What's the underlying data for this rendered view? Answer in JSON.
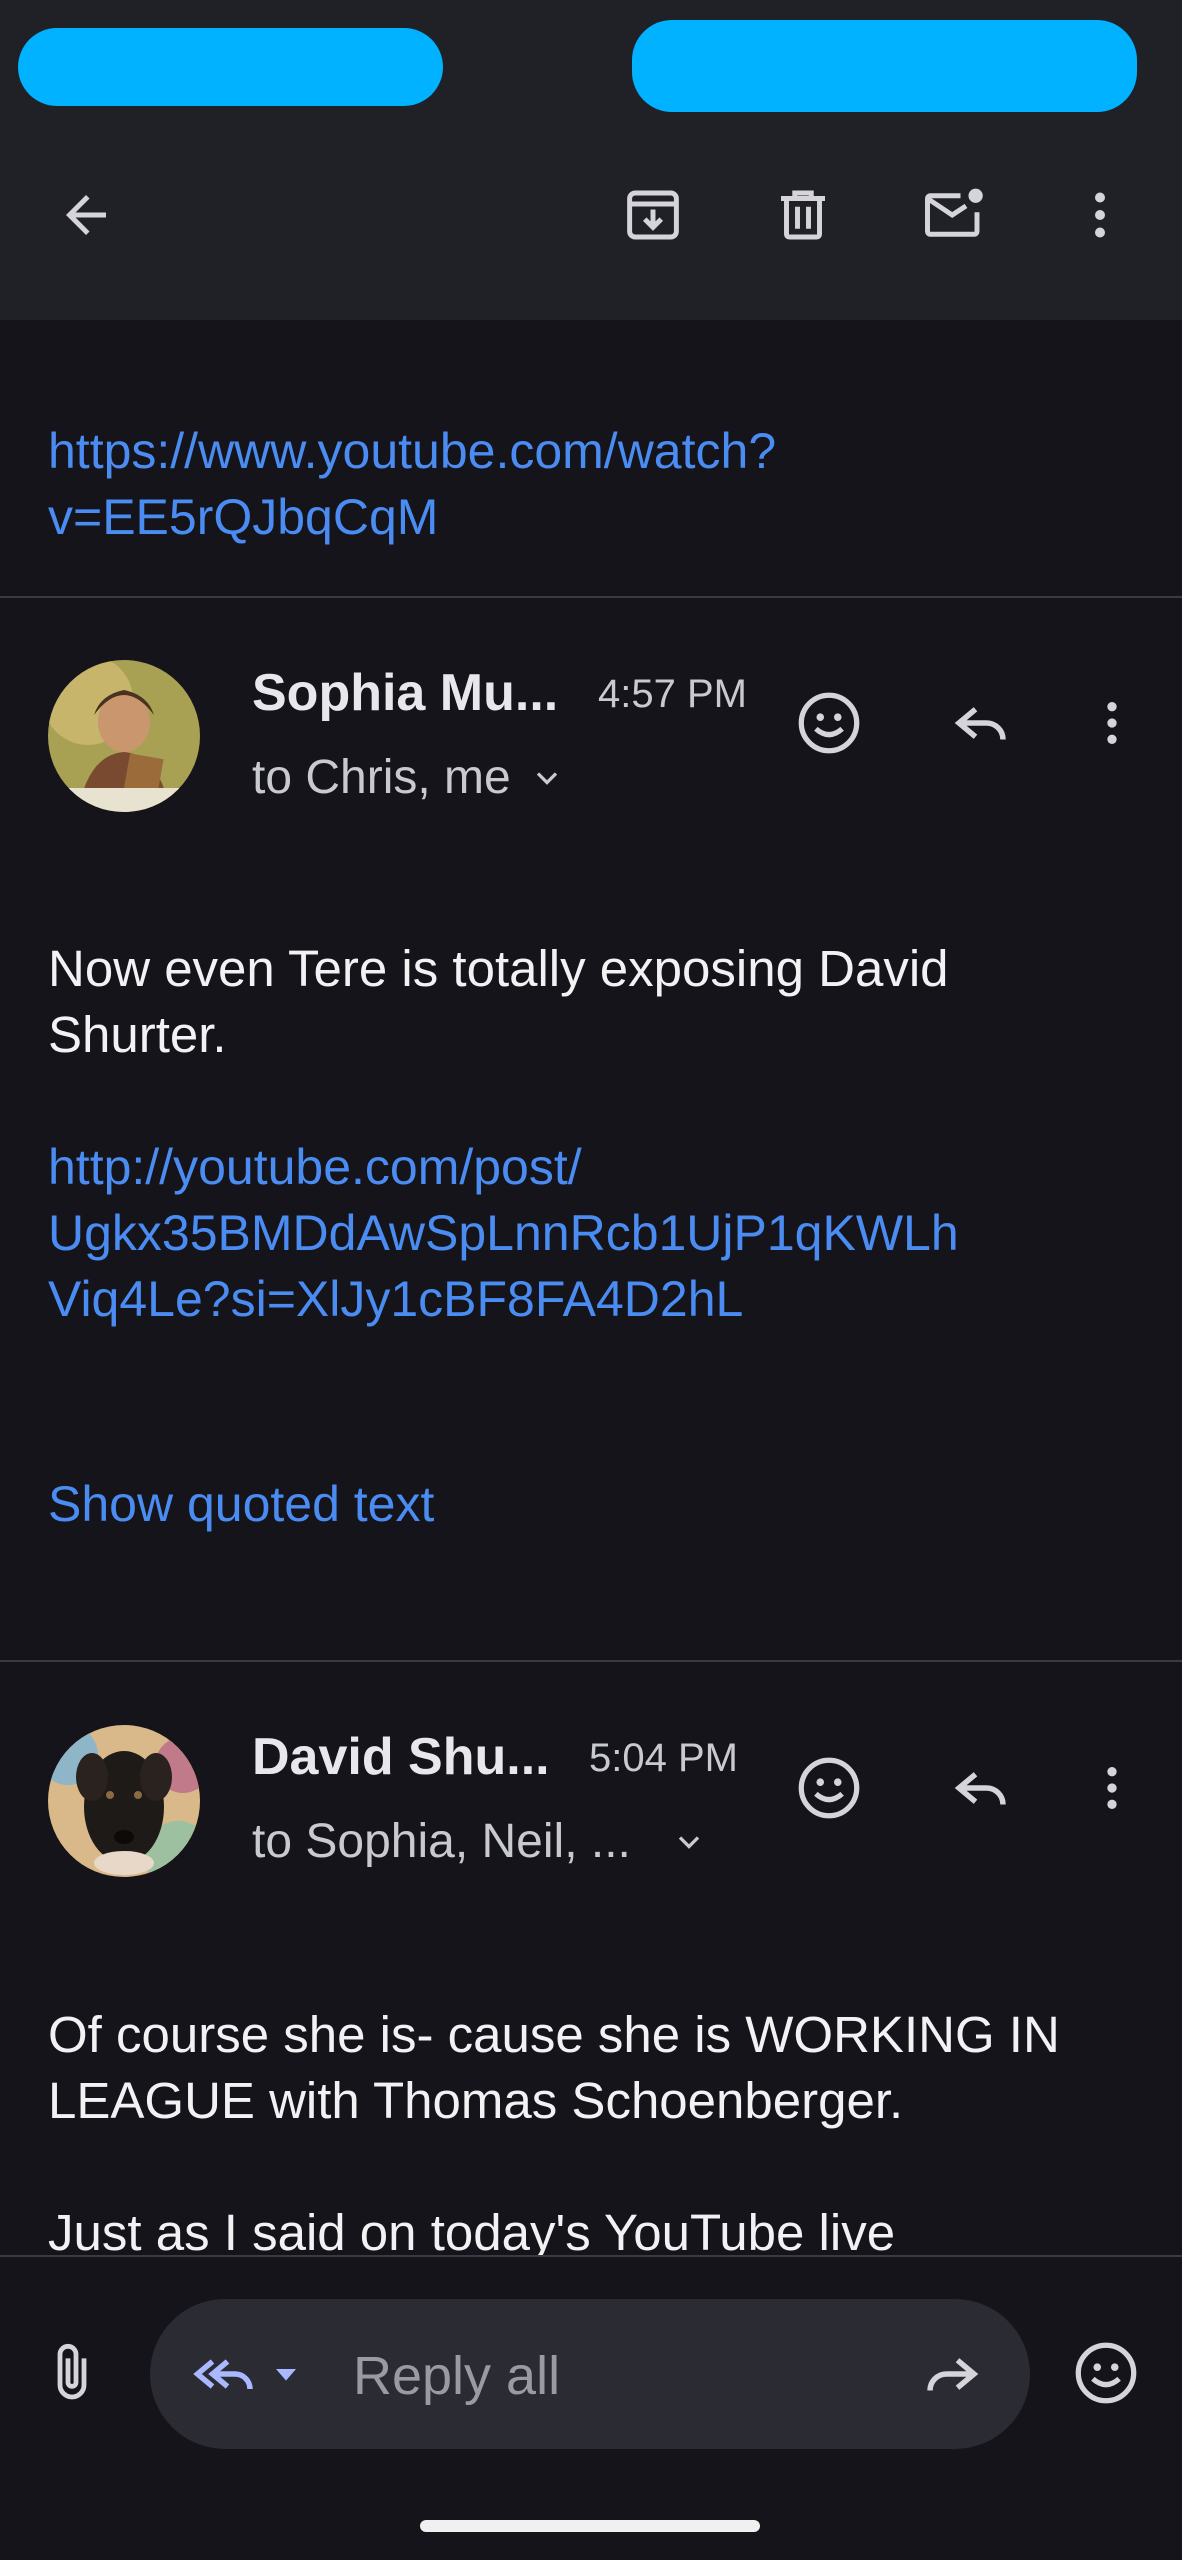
{
  "toolbar": {
    "back_icon": "arrow-left-icon",
    "archive_icon": "archive-icon",
    "delete_icon": "trash-icon",
    "mark_unread_icon": "mail-unread-icon",
    "more_icon": "more-vert-icon"
  },
  "previous_message": {
    "link": "https://www.youtube.com/watch?v=EE5rQJbqCqM",
    "link_line1": "https://www.youtube.com/watch?",
    "link_line2": "v=EE5rQJbqCqM"
  },
  "messages": [
    {
      "sender": "Sophia Mu...",
      "time": "4:57 PM",
      "recipients": "to Chris, me",
      "body": "Now even Tere is totally exposing David Shurter.",
      "link_line1": "http://youtube.com/post/",
      "link_line2": "Ugkx35BMDdAwSpLnnRcb1UjP1qKWLh",
      "link_line3": "Viq4Le?si=XlJy1cBF8FA4D2hL",
      "show_quoted": "Show quoted text"
    },
    {
      "sender": "David Shu...",
      "time": "5:04 PM",
      "recipients": "to Sophia, Neil, ...",
      "body": "Of course she is- cause she is WORKING IN LEAGUE with Thomas Schoenberger.",
      "body2": "Just as I said on today's YouTube live"
    }
  ],
  "reply_bar": {
    "placeholder": "Reply all"
  },
  "colors": {
    "background": "#14141a",
    "bar": "#202127",
    "link": "#4a8cf2",
    "redaction": "#00b2ff"
  }
}
